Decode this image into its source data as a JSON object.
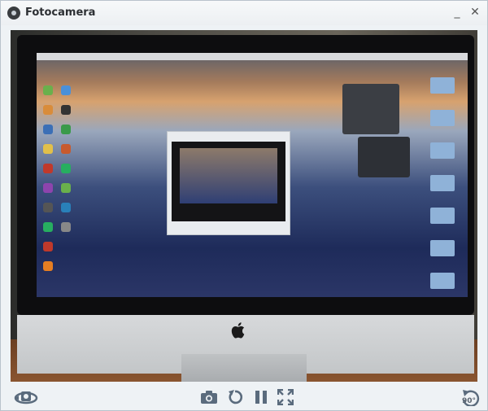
{
  "window": {
    "title": "Fotocamera",
    "minimize_glyph": "_",
    "close_glyph": "✕"
  },
  "toolbar": {
    "rotate_label": "90°"
  },
  "colors": {
    "icon_color": "#5a6b7d",
    "titlebar_text": "#2c2f33"
  },
  "icons": [
    "camera-app-icon",
    "minimize-icon",
    "close-icon",
    "switch-camera-icon",
    "camera-shutter-icon",
    "refresh-icon",
    "pause-icon",
    "fullscreen-icon",
    "rotate-90-icon"
  ]
}
